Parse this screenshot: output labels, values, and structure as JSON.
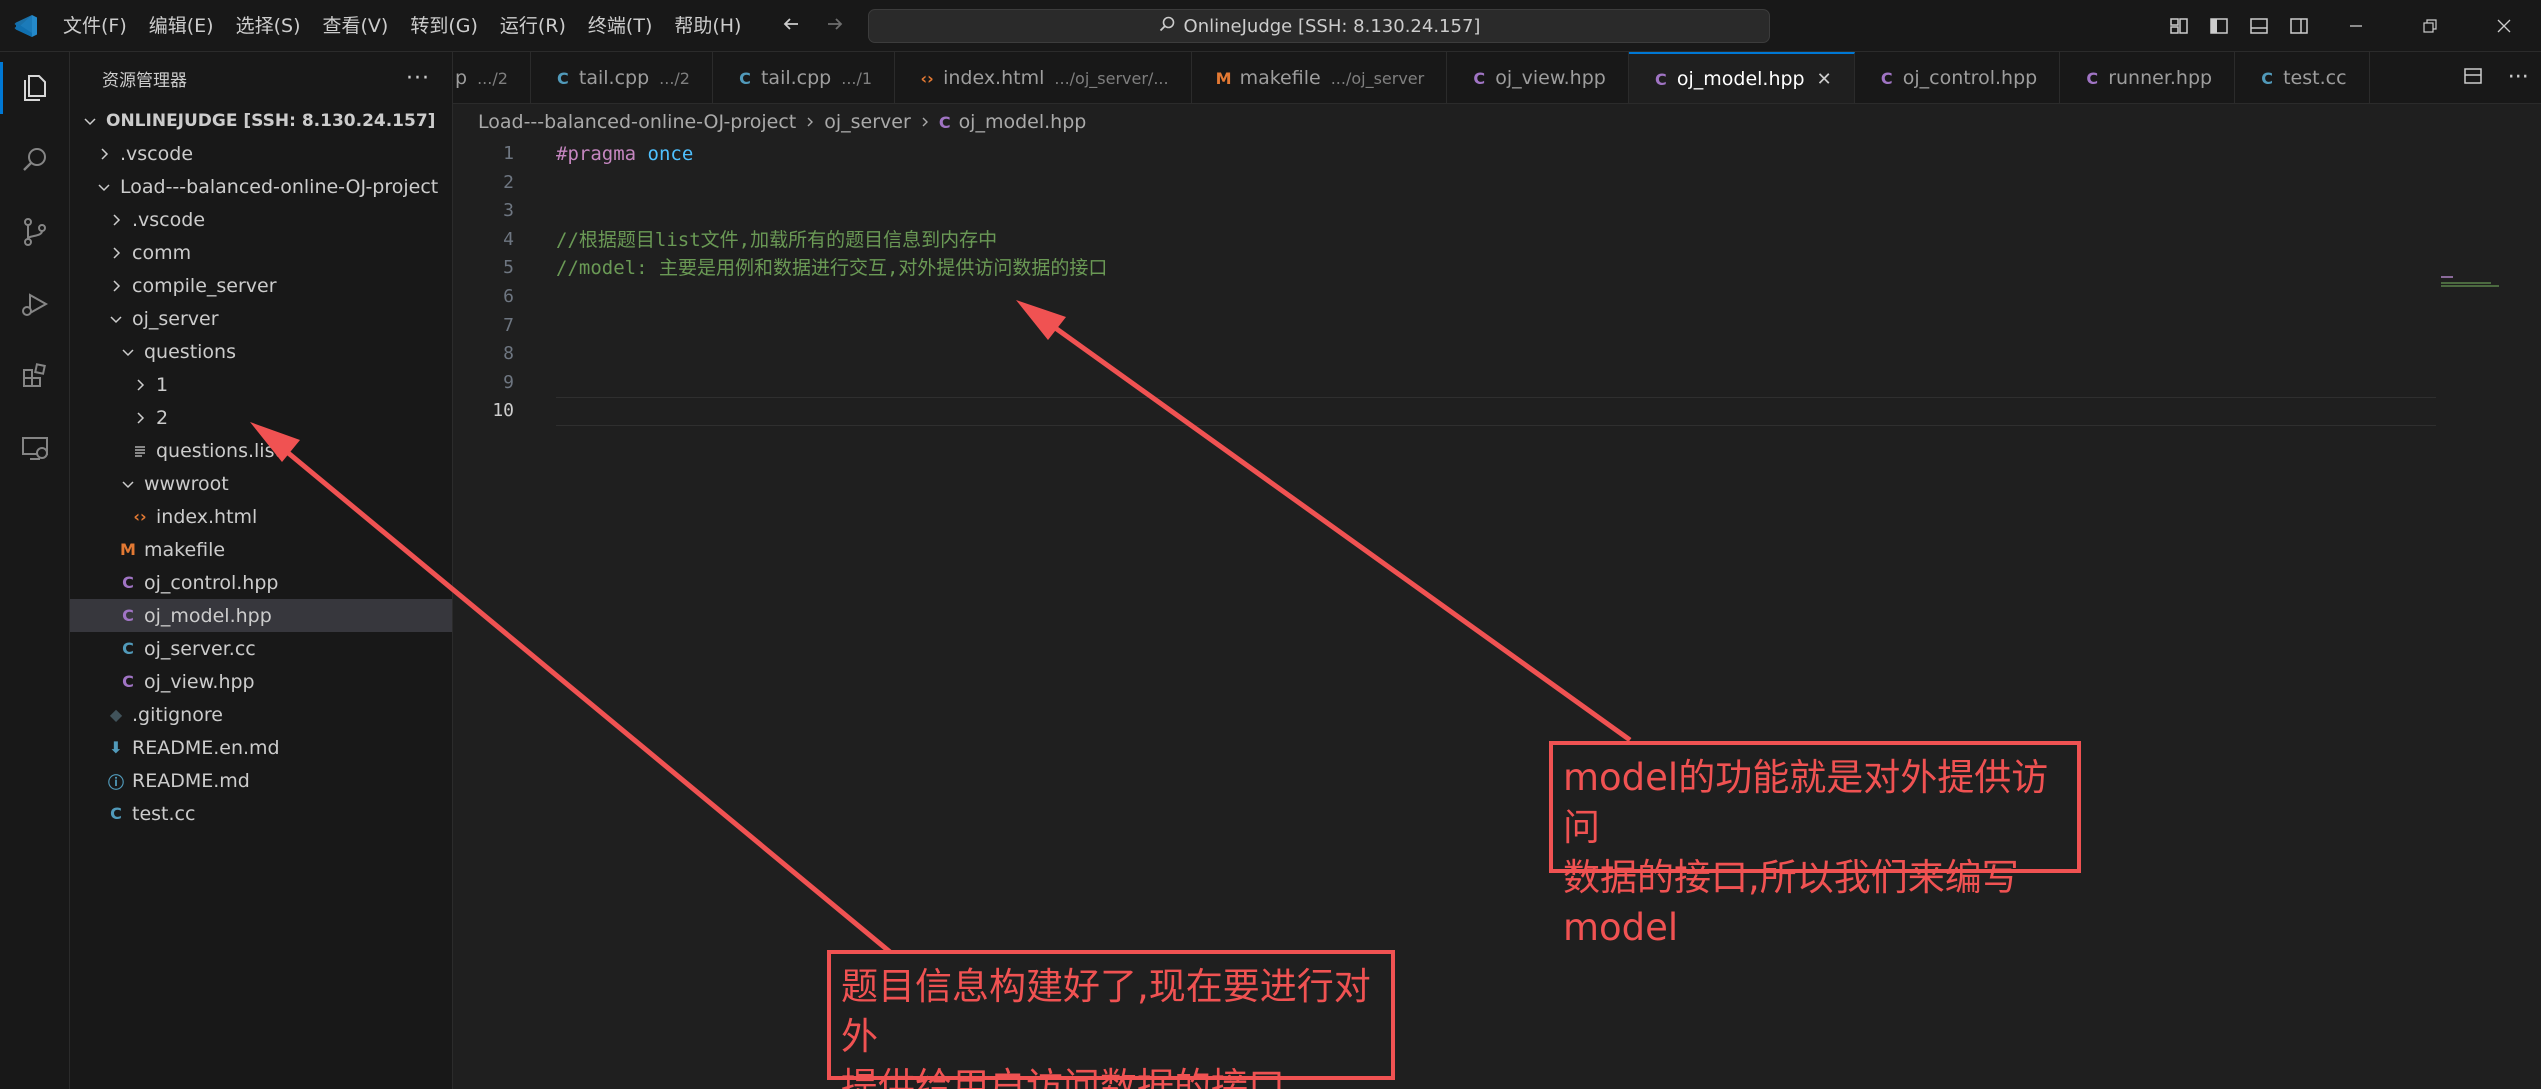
{
  "titlebar": {
    "menu": [
      "文件(F)",
      "编辑(E)",
      "选择(S)",
      "查看(V)",
      "转到(G)",
      "运行(R)",
      "终端(T)",
      "帮助(H)"
    ],
    "command_center": "OnlineJudge [SSH: 8.130.24.157]"
  },
  "sidebar": {
    "title": "资源管理器",
    "more": "···",
    "root": "ONLINEJUDGE [SSH: 8.130.24.157]",
    "items": [
      {
        "label": ".vscode"
      },
      {
        "label": "Load---balanced-online-OJ-project"
      },
      {
        "label": ".vscode"
      },
      {
        "label": "comm"
      },
      {
        "label": "compile_server"
      },
      {
        "label": "oj_server"
      },
      {
        "label": "questions"
      },
      {
        "label": "1"
      },
      {
        "label": "2"
      },
      {
        "label": "questions.list"
      },
      {
        "label": "wwwroot"
      },
      {
        "label": "index.html"
      },
      {
        "label": "makefile"
      },
      {
        "label": "oj_control.hpp"
      },
      {
        "label": "oj_model.hpp"
      },
      {
        "label": "oj_server.cc"
      },
      {
        "label": "oj_view.hpp"
      },
      {
        "label": ".gitignore"
      },
      {
        "label": "README.en.md"
      },
      {
        "label": "README.md"
      },
      {
        "label": "test.cc"
      }
    ]
  },
  "tabs": [
    {
      "label": "p",
      "desc": ".../2"
    },
    {
      "label": "tail.cpp",
      "desc": ".../2"
    },
    {
      "label": "tail.cpp",
      "desc": ".../1"
    },
    {
      "label": "index.html",
      "desc": ".../oj_server/..."
    },
    {
      "label": "makefile",
      "desc": ".../oj_server"
    },
    {
      "label": "oj_view.hpp",
      "desc": ""
    },
    {
      "label": "oj_model.hpp",
      "desc": "",
      "close": "✕"
    },
    {
      "label": "oj_control.hpp",
      "desc": ""
    },
    {
      "label": "runner.hpp",
      "desc": ""
    },
    {
      "label": "test.cc",
      "desc": ""
    }
  ],
  "breadcrumb": [
    "Load---balanced-online-OJ-project",
    "oj_server",
    "oj_model.hpp"
  ],
  "editor": {
    "line_numbers": [
      "1",
      "2",
      "3",
      "4",
      "5",
      "6",
      "7",
      "8",
      "9",
      "10"
    ],
    "line1_kw": "#pragma",
    "line1_id": "once",
    "line4": "//根据题目list文件,加载所有的题目信息到内存中",
    "line5": "//model: 主要是用例和数据进行交互,对外提供访问数据的接口"
  },
  "annotations": {
    "right_line1": "model的功能就是对外提供访问",
    "right_line2": "数据的接口,所以我们来编写model",
    "bottom_line1": "题目信息构建好了,现在要进行对外",
    "bottom_line2": "提供给用户访问数据的接口"
  },
  "colors": {
    "accent": "#0078d4",
    "annotation_red": "#f05252",
    "comment_green": "#6a9955",
    "keyword_purple": "#c586c0"
  }
}
